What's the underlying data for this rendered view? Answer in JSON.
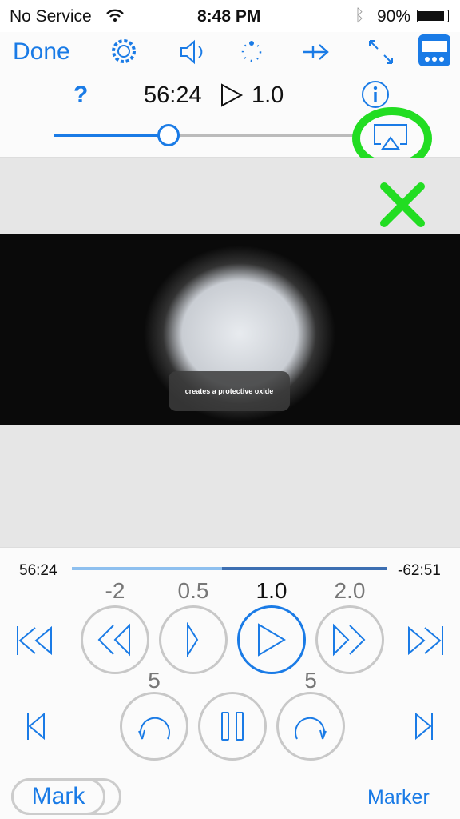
{
  "status": {
    "carrier": "No Service",
    "time": "8:48 PM",
    "battery": "90%"
  },
  "toolbar": {
    "done_label": "Done",
    "icons": [
      "gear-icon",
      "speaker-icon",
      "dotted-circle-icon",
      "arrow-right-icon",
      "expand-icon",
      "player-layout-icon"
    ]
  },
  "info": {
    "help_label": "?",
    "position": "56:24",
    "speed": "1.0"
  },
  "volume": {
    "level": 0.38
  },
  "video": {
    "caption": "creates a protective oxide"
  },
  "progress": {
    "elapsed": "56:24",
    "remaining": "-62:51",
    "fraction": 0.475
  },
  "speeds": [
    {
      "label": "-2"
    },
    {
      "label": "0.5"
    },
    {
      "label": "1.0"
    },
    {
      "label": "2.0"
    }
  ],
  "skip": {
    "back_label": "5",
    "forward_label": "5"
  },
  "footer": {
    "mark_label": "Mark",
    "marker_label": "Marker"
  },
  "colors": {
    "accent": "#1a7be6",
    "annotation": "#22dd22"
  }
}
